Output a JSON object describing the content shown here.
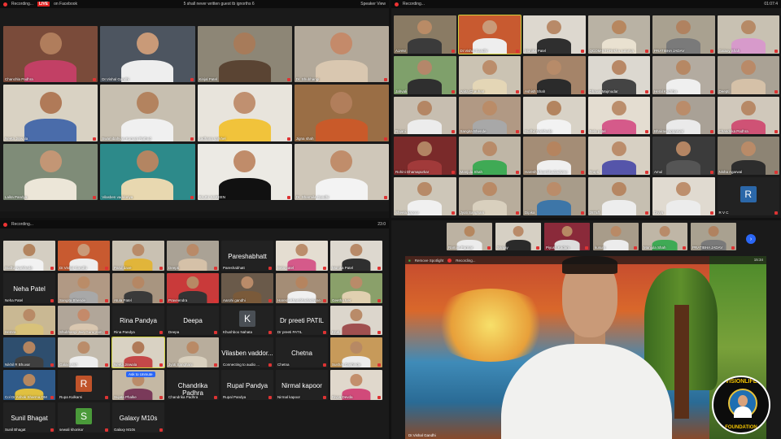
{
  "q1": {
    "topbar": {
      "recording": "Recording...",
      "live": "LIVE",
      "platform": "on Facebook",
      "center": "5 shall never written guest tb ignorths 6",
      "view": "Speaker View"
    },
    "tiles": [
      {
        "name": "Chanchla Padhra",
        "bg": "#7a4b3a",
        "skin": "#b07d5c",
        "body": "#c24065"
      },
      {
        "name": "Dr.Vishal Gandhi",
        "bg": "#4d5560",
        "skin": "#c99a78",
        "body": "#eeeeee"
      },
      {
        "name": "Kinjal Patel",
        "bg": "#8d8676",
        "skin": "#a77b5a",
        "body": "#5a4433"
      },
      {
        "name": "Dr. Shubhangi",
        "bg": "#b3a99a",
        "skin": "#c48a6a",
        "body": "#d9c7b0"
      },
      {
        "name": "Neeta Jinwala",
        "bg": "#d9d2c3",
        "skin": "#b07a58",
        "body": "#4a6caa"
      },
      {
        "name": "Swamibahvan Kumarji Rathod",
        "bg": "#c7bfb0",
        "skin": "#b3835f",
        "body": "#f0f0f0"
      },
      {
        "name": "sadhana sarkhel",
        "bg": "#e8e4dc",
        "skin": "#c09070",
        "body": "#f1c33b"
      },
      {
        "name": "Jigna shah",
        "bg": "#9a6e45",
        "skin": "#b17e5b",
        "body": "#c95a2a"
      },
      {
        "name": "Lalita Pandya",
        "bg": "#7f8c78",
        "skin": "#c39675",
        "body": "#ece6d8"
      },
      {
        "name": "Vilasben vaddoriya",
        "bg": "#2d8a8a",
        "skin": "#b38562",
        "body": "#e8d8b0"
      },
      {
        "name": "RAJIV SAREEN",
        "bg": "#eceae4",
        "skin": "#c08c6a",
        "body": "#111111"
      },
      {
        "name": "Dr. Sharmila Gandhi",
        "bg": "#cfc7b9",
        "skin": "#c08d6b",
        "body": "#f3f3f3"
      }
    ]
  },
  "q2": {
    "topbar": {
      "recording": "Recording...",
      "time": "01:07:4"
    },
    "tiles": [
      {
        "name": "AJANI",
        "bg": "#8a7b64",
        "skin": "#b98b66",
        "body": "#3b3b3b"
      },
      {
        "name": "Dr.Vishal Gandhi",
        "bg": "#c85a30",
        "skin": "#c99a78",
        "body": "#eeeeee",
        "active": true
      },
      {
        "name": "Monika Patel",
        "bg": "#ddd8cf",
        "skin": "#b88a68",
        "body": "#2f2f2f"
      },
      {
        "name": "QCOM-BTDRekha sutariya",
        "bg": "#b9b2a4",
        "skin": "#b7875f",
        "body": "#e9e1d0"
      },
      {
        "name": "PRATIBHA JADAV",
        "bg": "#a9a190",
        "skin": "#b08260",
        "body": "#7a7a7a"
      },
      {
        "name": "Galaxy Shah",
        "bg": "#c8c1b2",
        "skin": "#b68a66",
        "body": "#d79acb"
      },
      {
        "name": "Jahvali",
        "bg": "#7fa06b",
        "skin": "#b4876a",
        "body": "#2f2f2f"
      },
      {
        "name": "Anita Chauhan",
        "bg": "#cbc3b3",
        "skin": "#bb8d6b",
        "body": "#e4d6b6"
      },
      {
        "name": "Ashish Shah",
        "bg": "#a58469",
        "skin": "#b78b69",
        "body": "#2b2b2b"
      },
      {
        "name": "Dhaval Majmudar",
        "bg": "#dcd8d0",
        "skin": "#b88866",
        "body": "#444444"
      },
      {
        "name": "Heral Kachhia",
        "bg": "#b3aba0",
        "skin": "#b68864",
        "body": "#efefef"
      },
      {
        "name": "Deepti",
        "bg": "#aaa295",
        "skin": "#b98a68",
        "body": "#d5c1a8"
      },
      {
        "name": "Rajani",
        "bg": "#c7beb0",
        "skin": "#b48664",
        "body": "#ececec"
      },
      {
        "name": "Sangita Bhende",
        "bg": "#b19984",
        "skin": "#ba8c68",
        "body": "#a8a8a8"
      },
      {
        "name": "Sudhir Narkhede",
        "bg": "#d8d2c6",
        "skin": "#b3845f",
        "body": "#f2f2f2"
      },
      {
        "name": "Bela patel",
        "bg": "#e4ddd1",
        "skin": "#bb8e6c",
        "body": "#d55a8a"
      },
      {
        "name": "Bhairavi Aggarwal",
        "bg": "#a9a196",
        "skin": "#ba8c6a",
        "body": "#eaeaea"
      },
      {
        "name": "Chandrika Padhra",
        "bg": "#d0c8bb",
        "skin": "#b78966",
        "body": "#cf5275"
      },
      {
        "name": "Rohini Dhamapurkar",
        "bg": "#7a2a2a",
        "skin": "#b28463",
        "body": "#a13a3a"
      },
      {
        "name": "Manjula Shah",
        "bg": "#bfb6a6",
        "skin": "#b88b69",
        "body": "#3faa55"
      },
      {
        "name": "Haresh Khambhadiadivine",
        "bg": "#a48d76",
        "skin": "#b5845f",
        "body": "#f0f0f0"
      },
      {
        "name": "Trupti",
        "bg": "#d7d0c3",
        "skin": "#bb8d6b",
        "body": "#5555aa"
      },
      {
        "name": "Amul",
        "bg": "#3b3b3b",
        "skin": "#b48563",
        "body": "#555555"
      },
      {
        "name": "Nisha Agarwal",
        "bg": "#8d8474",
        "skin": "#b98b68",
        "body": "#2d2d2d"
      },
      {
        "name": "Sheela kapoor",
        "bg": "#cdc6b8",
        "skin": "#b78a68",
        "body": "#f0f0f0"
      },
      {
        "name": "Jyoti Sanghani",
        "bg": "#b8ad9c",
        "skin": "#b98a66",
        "body": "#d9d0be"
      },
      {
        "name": "Dipika",
        "bg": "#a89c8a",
        "skin": "#ba8c6a",
        "body": "#3d76a8"
      },
      {
        "name": "287aff",
        "bg": "#c6bfb1",
        "skin": "#b68763",
        "body": "#ededed"
      },
      {
        "name": "Divya",
        "bg": "#e0dad0",
        "skin": "#bd8f6d",
        "body": "#ececec"
      },
      {
        "name": "R V C",
        "avatar": "R",
        "avatarColor": "#2b67a8"
      }
    ]
  },
  "q3": {
    "topbar": {
      "recording": "Recording...",
      "time": "23:0"
    },
    "toast": "Ask to Unmute",
    "tiles": [
      {
        "name": "Sudhir Narkhede",
        "bg": "#d4cec2",
        "skin": "#b3845f",
        "body": "#f2f2f2"
      },
      {
        "name": "Dr.Vishal Gandhi",
        "bg": "#c85a30",
        "skin": "#c99a78",
        "body": "#eeeeee"
      },
      {
        "name": "Parul dave",
        "bg": "#c9c1b2",
        "skin": "#b98b69",
        "body": "#e1b53a"
      },
      {
        "name": "Deepti",
        "bg": "#aaa295",
        "skin": "#b98a68",
        "body": "#d5c1a8"
      },
      {
        "name": "Pareshabhatt",
        "text": "Pareshabhatt"
      },
      {
        "name": "Bela patel",
        "bg": "#e4ddd1",
        "skin": "#bb8e6c",
        "body": "#d55a8a"
      },
      {
        "name": "Monika Patel",
        "bg": "#ddd8cf",
        "skin": "#b88a68",
        "body": "#2f2f2f"
      },
      {
        "name": "Neha Patel",
        "text": "Neha Patel"
      },
      {
        "name": "Sangita Bhende",
        "bg": "#b19984",
        "skin": "#ba8c68",
        "body": "#a8a8a8"
      },
      {
        "name": "Atula Patel",
        "bg": "#a89580",
        "skin": "#b58764",
        "body": "#3a3a3a"
      },
      {
        "name": "Praveendra",
        "bg": "#c93a3a",
        "skin": "#b78964",
        "body": "#333333"
      },
      {
        "name": "Aarohi gandhi",
        "bg": "#6a5a4a",
        "skin": "#b98b69",
        "body": "#7a5a3a"
      },
      {
        "name": "Haresh Khambhadiadivine",
        "bg": "#a48d76",
        "skin": "#b5845f",
        "body": "#f0f0f0"
      },
      {
        "name": "Geetha Iyer",
        "bg": "#8aa06a",
        "skin": "#b98b69",
        "body": "#e0d0b0"
      },
      {
        "name": "Hemra",
        "bg": "#c9b893",
        "skin": "#b88a66",
        "body": "#d8c27a"
      },
      {
        "name": "Shubhangi Jain,Gurugram",
        "bg": "#b1a699",
        "skin": "#c48a6a",
        "body": "#d9c7b0"
      },
      {
        "name": "Rina Pandya",
        "text": "Rina Pandya"
      },
      {
        "name": "Deepa",
        "text": "Deepa"
      },
      {
        "name": "Khushboo Nahata",
        "avatar": "K",
        "avatarColor": "#4a4f55"
      },
      {
        "name": "Dr preeti PATIL",
        "text": "Dr preeti  PATIL"
      },
      {
        "name": "Kruti",
        "bg": "#dcd6cc",
        "skin": "#b98b69",
        "body": "#a05050"
      },
      {
        "name": "Nikhil R Bhuvar",
        "bg": "#2e4e6e",
        "skin": "#b4845f",
        "body": "#3f3f3f"
      },
      {
        "name": "Galaxy AVI",
        "bg": "#c3bbad",
        "skin": "#ba8c6a",
        "body": "#ededed"
      },
      {
        "name": "Neeta Jinwala",
        "bg": "#d9d2c3",
        "skin": "#b07a58",
        "body": "#c44848",
        "active": true
      },
      {
        "name": "Jyoti Sanghani",
        "bg": "#b8ad9c",
        "skin": "#b98a66",
        "body": "#d9d0be"
      },
      {
        "name": "Connecting to audio ...",
        "text": "Vilasben vaddor..."
      },
      {
        "name": "Chetna",
        "text": "Chetna"
      },
      {
        "name": "Sushas Dakhinde",
        "bg": "#c79a5a",
        "skin": "#b78964",
        "body": "#ececec"
      },
      {
        "name": "Col Dr Ashok Sharma,OM",
        "bg": "#2f5a8a",
        "skin": "#b5875f",
        "body": "#e0c040"
      },
      {
        "name": "Rupa Kulkarni",
        "avatar": "R",
        "avatarColor": "#c0532a"
      },
      {
        "name": "Sujata Phalke",
        "bg": "#c4b8a4",
        "skin": "#ba8c6a",
        "body": "#7a3a5a"
      },
      {
        "name": "Chandrika Padhra",
        "text": "Chandrika Padhra"
      },
      {
        "name": "Rupal Pandya",
        "text": "Rupal Pandya"
      },
      {
        "name": "Nirmal kapoor",
        "text": "Nirmal kapoor"
      },
      {
        "name": "Divya Devda",
        "bg": "#e0d8cc",
        "skin": "#c38f6c",
        "body": "#d14a7a"
      },
      {
        "name": "Sunil Bhagat",
        "text": "Sunil Bhagat"
      },
      {
        "name": "sewali khonkor",
        "avatar": "S",
        "avatarColor": "#4a9a3a"
      },
      {
        "name": "Galaxy M10s",
        "text": "Galaxy M10s"
      }
    ]
  },
  "q4": {
    "strip": [
      {
        "name": "Raman Parmar",
        "bg": "#bcb2a2",
        "skin": "#b5875f",
        "body": "#ececec"
      },
      {
        "name": "Sanjay",
        "bg": "#d6d0c4",
        "skin": "#b98b69",
        "body": "#2a2a2a"
      },
      {
        "name": "Piyush Kadam",
        "bg": "#8a2a3a",
        "skin": "#b78964",
        "body": "#dddddd"
      },
      {
        "name": "kusum",
        "bg": "#a89c8a",
        "skin": "#b98a66",
        "body": "#ececec"
      },
      {
        "name": "Manjula Shah",
        "bg": "#bfb6a6",
        "skin": "#b88b69",
        "body": "#3faa55"
      },
      {
        "name": "PRATIBHA JADAV",
        "bg": "#a9a190",
        "skin": "#b08260",
        "body": "#7a7a7a"
      }
    ],
    "next": "›",
    "speaker": {
      "remove_spotlight": "Remove Spotlight",
      "recording": "Recording...",
      "time": "15:34",
      "name": "Dr.Vishal Gandhi"
    },
    "logo": {
      "line1": "VISIONLIFE",
      "line2": "FOUNDATION"
    }
  }
}
